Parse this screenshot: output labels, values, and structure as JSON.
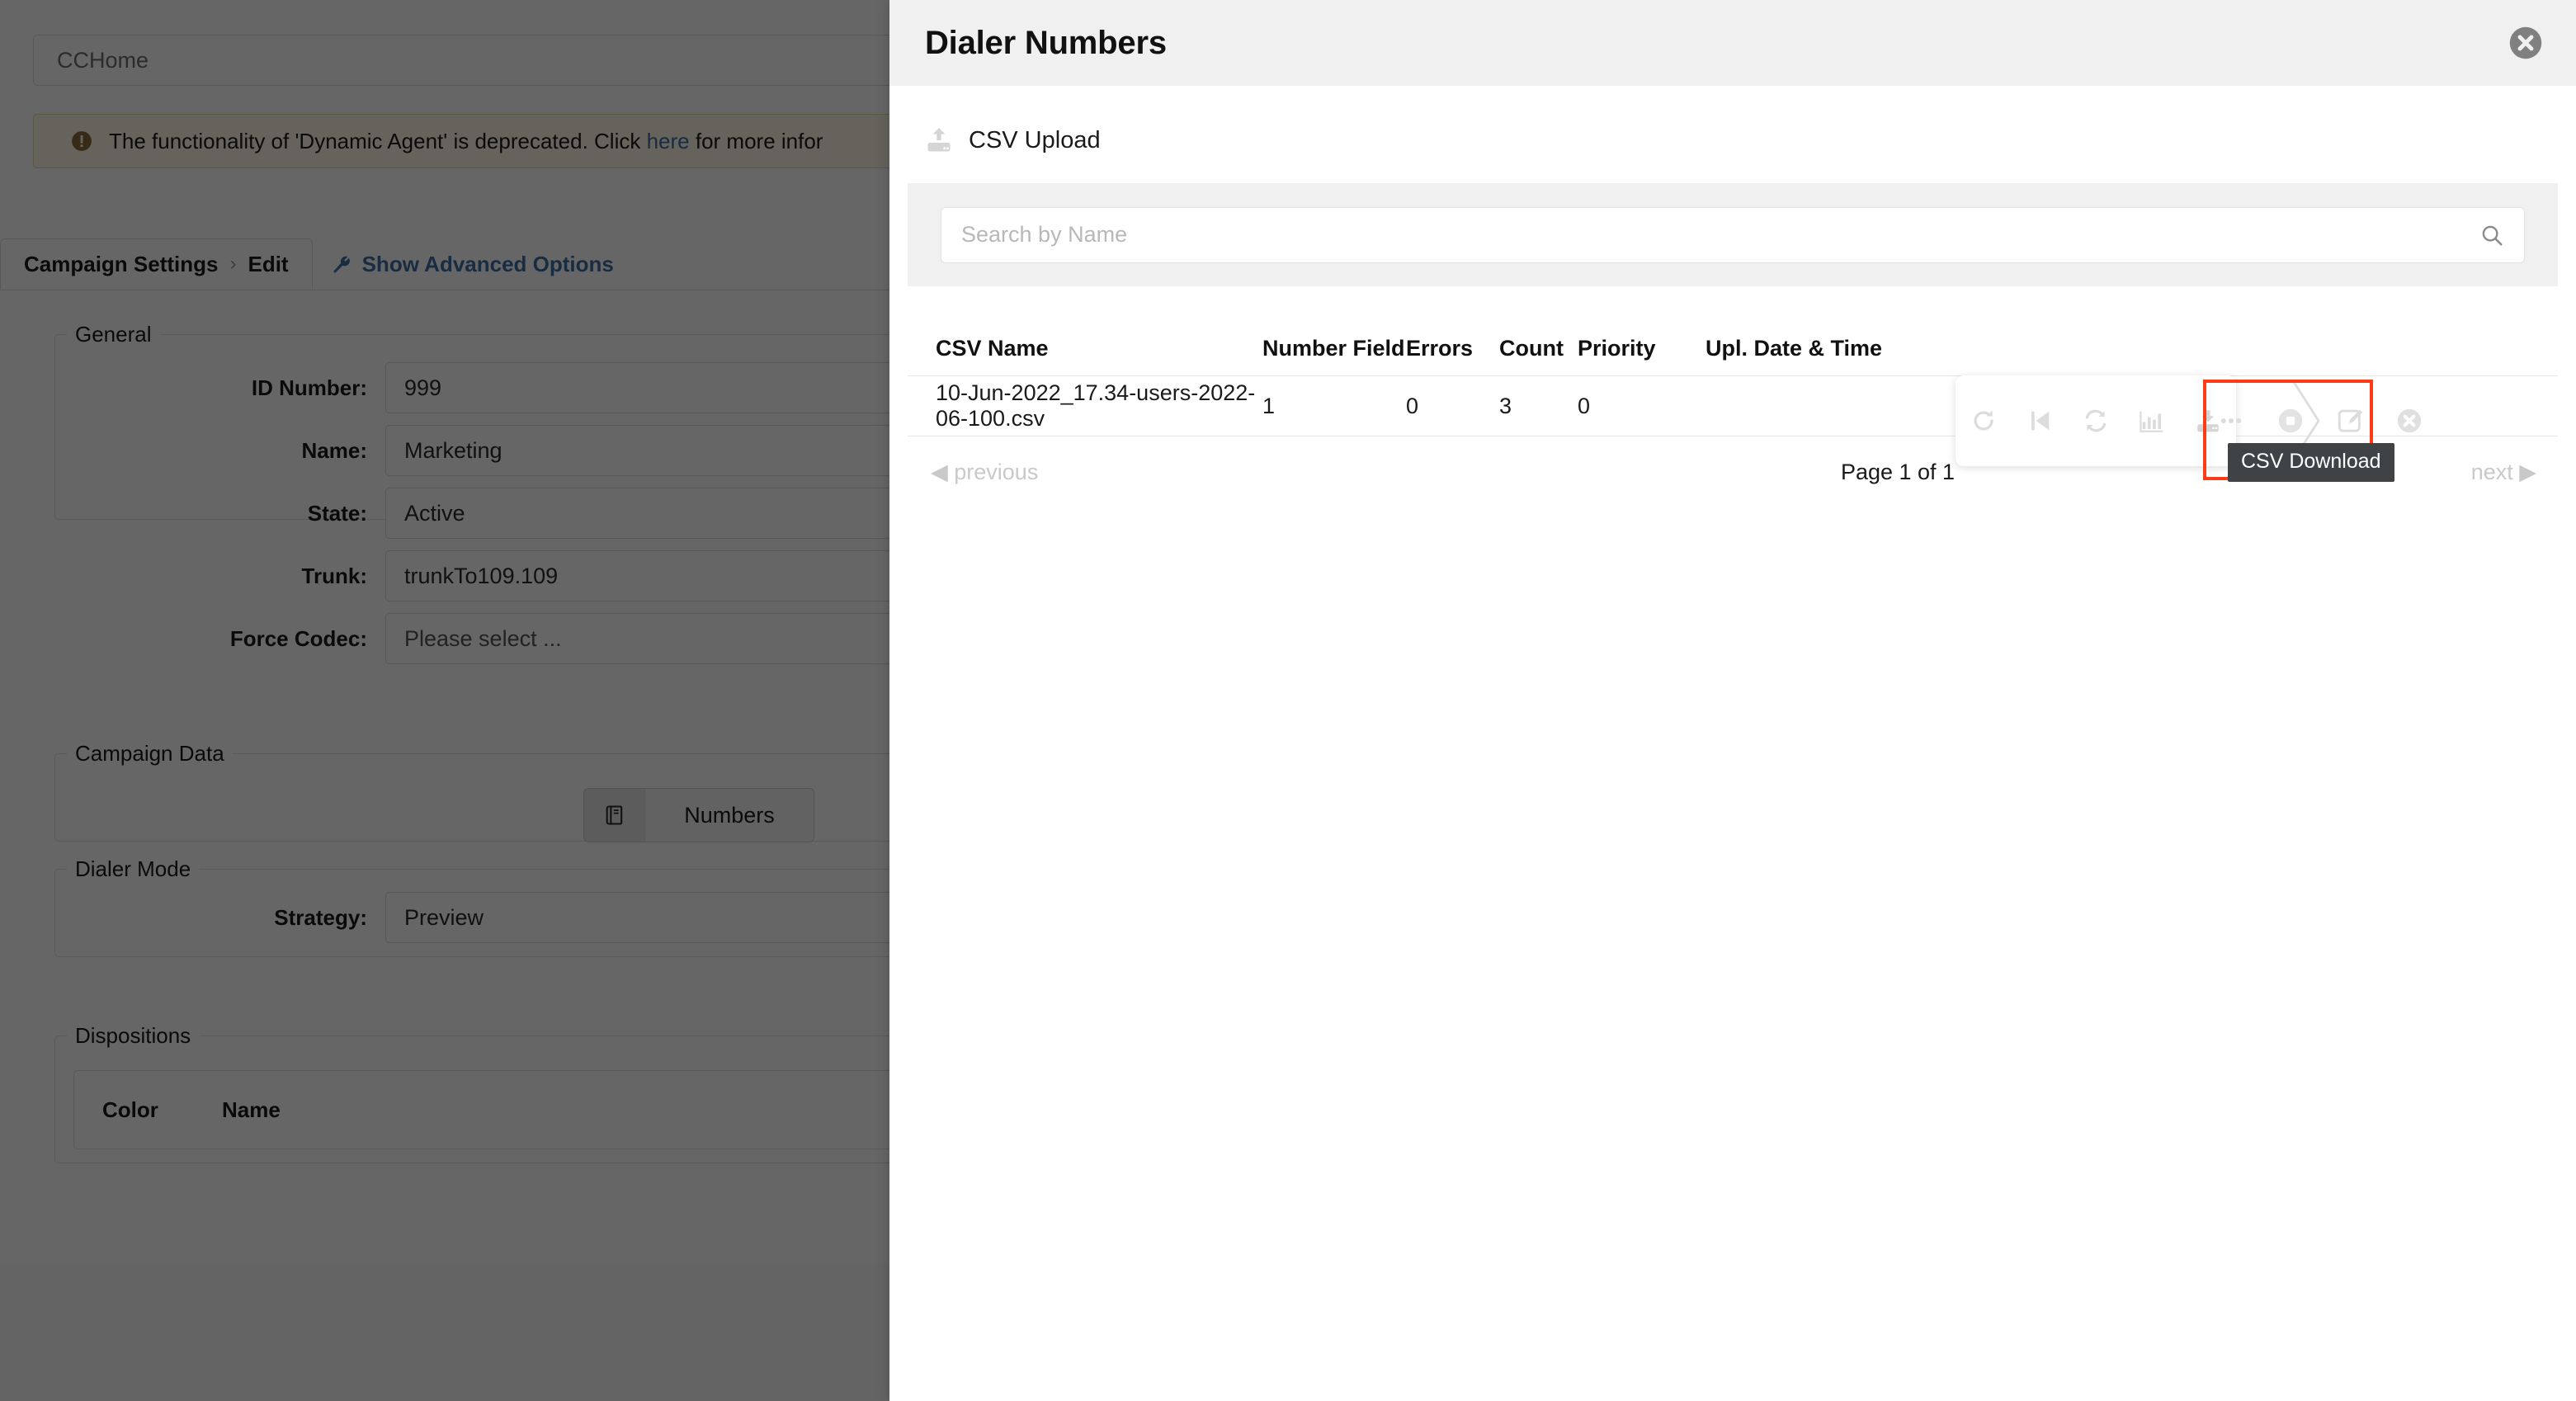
{
  "background": {
    "breadcrumb_value": "CCHome",
    "alert": {
      "icon": "exclamation-circle-icon",
      "text_before": "The functionality of 'Dynamic Agent' is deprecated. Click ",
      "link_text": "here",
      "text_after": " for more infor"
    },
    "tabs": {
      "campaign_settings": "Campaign Settings",
      "separator": "›",
      "edit": "Edit",
      "advanced_options": "Show Advanced Options"
    },
    "general": {
      "legend": "General",
      "fields": [
        {
          "label": "ID Number:",
          "value": "999",
          "placeholder": false
        },
        {
          "label": "Name:",
          "value": "Marketing",
          "placeholder": false
        },
        {
          "label": "State:",
          "value": "Active",
          "placeholder": false
        },
        {
          "label": "Trunk:",
          "value": "trunkTo109.109",
          "placeholder": false
        },
        {
          "label": "Force Codec:",
          "value": "Please select ...",
          "placeholder": true
        }
      ]
    },
    "campaign_data": {
      "legend": "Campaign Data",
      "numbers_button_label": "Numbers",
      "numbers_button_icon": "book-icon"
    },
    "dialer_mode": {
      "legend": "Dialer Mode",
      "fields": [
        {
          "label": "Strategy:",
          "value": "Preview",
          "placeholder": false
        }
      ]
    },
    "dispositions": {
      "legend": "Dispositions",
      "columns": [
        "Color",
        "Name"
      ],
      "rows": []
    }
  },
  "modal": {
    "title": "Dialer Numbers",
    "close_icon": "close-circle-icon",
    "csv_upload": {
      "label": "CSV Upload",
      "icon": "upload-icon"
    },
    "search": {
      "placeholder": "Search by Name",
      "value": "",
      "icon": "search-icon"
    },
    "table": {
      "columns": [
        "CSV Name",
        "Number Field",
        "Errors",
        "Count",
        "Priority",
        "Upl. Date & Time"
      ],
      "rows": [
        {
          "csv_name": "10-Jun-2022_17.34-users-2022-06-100.csv",
          "number_field": "1",
          "errors": "0",
          "count": "3",
          "priority": "0",
          "upl_date_time": ""
        }
      ]
    },
    "pagination": {
      "previous": "previous",
      "page_info": "Page 1 of 1",
      "next": "next"
    },
    "action_toolbar": {
      "actions": [
        {
          "name": "restart-icon",
          "title": "Restart"
        },
        {
          "name": "skip-start-icon",
          "title": "Skip to start"
        },
        {
          "name": "refresh-icon",
          "title": "Refresh"
        },
        {
          "name": "statistics-icon",
          "title": "Statistics"
        },
        {
          "name": "csv-download-icon",
          "title": "CSV Download"
        },
        {
          "name": "more-options-icon",
          "title": "More"
        },
        {
          "name": "stop-icon",
          "title": "Stop"
        },
        {
          "name": "edit-icon",
          "title": "Edit"
        },
        {
          "name": "delete-icon",
          "title": "Delete"
        }
      ]
    },
    "highlight": {
      "tooltip_text": "CSV Download",
      "border_color": "#ff3b18",
      "tooltip_bg": "#3f4345"
    }
  }
}
